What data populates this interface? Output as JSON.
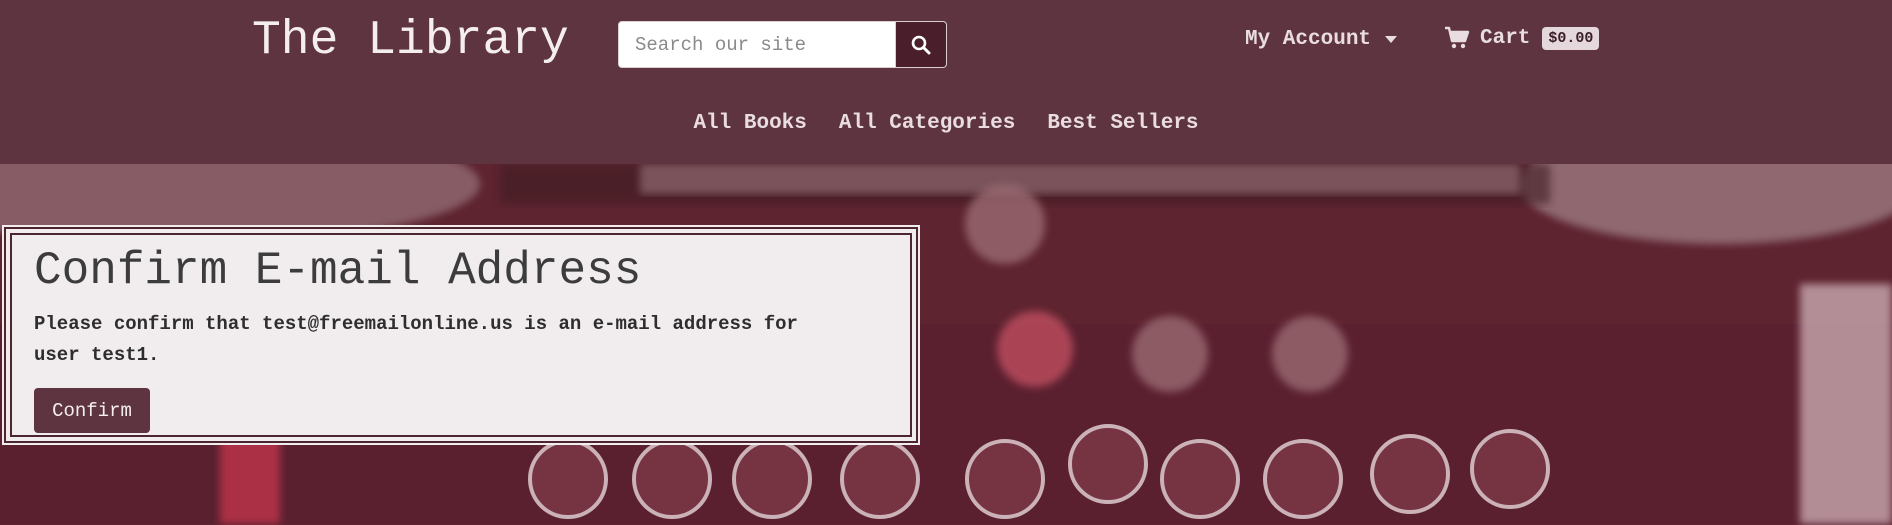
{
  "header": {
    "brand": "The Library",
    "search_placeholder": "Search our site",
    "search_button_icon": "search-icon",
    "account_label": "My Account",
    "cart_label": "Cart",
    "cart_total": "$0.00"
  },
  "nav": {
    "links": [
      "All Books",
      "All Categories",
      "Best Sellers"
    ]
  },
  "confirm": {
    "title": "Confirm E-mail Address",
    "message_prefix": "Please confirm that ",
    "email": "test@freemailonline.us",
    "message_middle": " is an e-mail address for user ",
    "username": "test1",
    "message_suffix": ".",
    "button_label": "Confirm"
  },
  "colors": {
    "brand": "#5e3440",
    "search_button": "#4a1f2b",
    "card_background": "#f1ecee"
  }
}
